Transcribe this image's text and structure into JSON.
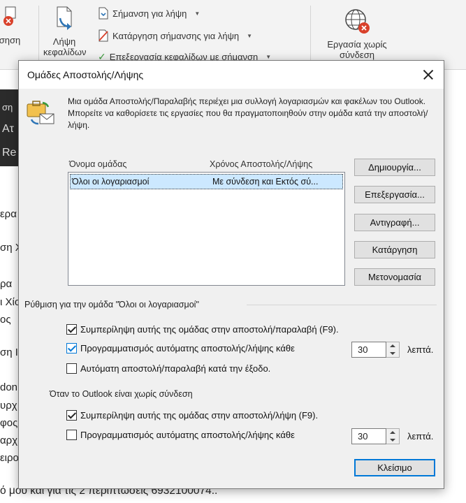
{
  "ribbon": {
    "left_label": "σηση",
    "download_label_line1": "Λήψη",
    "download_label_line2": "κεφαλίδων",
    "mark_download": "Σήμανση για λήψη",
    "unmark_download": "Κατάργηση σήμανσης για λήψη",
    "process_headers": "Επεξεργασία κεφαλίδων με σήμανση",
    "offline_line1": "Εργασία χωρίς",
    "offline_line2": "σύνδεση"
  },
  "background": {
    "pane_lines": [
      "ση",
      "Ατ",
      "Re"
    ],
    "lines": [
      "ερα",
      "ση Χ",
      "ρα",
      "ι Χίο",
      "ος",
      "ση Ι",
      "don",
      "υρχ",
      "φος",
      "αρχ",
      "ειρο"
    ],
    "bottom_line": "ό μου και για τις 2 περιπτώσεις 6932100074.."
  },
  "dialog": {
    "title": "Ομάδες Αποστολής/Λήψης",
    "description": "Μια ομάδα Αποστολής/Παραλαβής περιέχει μια συλλογή λογαριασμών και φακέλων του Outlook. Μπορείτε να καθορίσετε τις εργασίες που θα πραγματοποιηθούν στην ομάδα κατά την αποστολή/λήψη.",
    "columns": [
      "Όνομα ομάδας",
      "Χρόνος Αποστολής/Λήψης"
    ],
    "rows": [
      {
        "name": "Όλοι οι λογαριασμοί",
        "time": "Με σύνδεση και Εκτός σύ..."
      }
    ],
    "buttons": {
      "create": "Δημιουργία...",
      "edit": "Επεξεργασία...",
      "copy": "Αντιγραφή...",
      "remove": "Κατάργηση",
      "rename": "Μετονομασία",
      "close": "Κλείσιμο"
    },
    "settings_label": "Ρύθμιση για την ομάδα \"Όλοι οι λογαριασμοί\"",
    "online": {
      "include_label": "Συμπερίληψη αυτής της ομάδας στην αποστολή/παραλαβή (F9).",
      "include_checked": true,
      "schedule_label": "Προγραμματισμός αυτόματης αποστολής/λήψης κάθε",
      "schedule_checked": true,
      "schedule_minutes": "30",
      "minutes_unit": "λεπτά.",
      "on_exit_label": "Αυτόματη αποστολή/παραλαβή κατά την έξοδο.",
      "on_exit_checked": false
    },
    "offline_label": "Όταν το Outlook είναι χωρίς σύνδεση",
    "offline": {
      "include_label": "Συμπερίληψη αυτής της ομάδας στην αποστολή/λήψη (F9).",
      "include_checked": true,
      "schedule_label": "Προγραμματισμός αυτόματης αποστολής/λήψης κάθε",
      "schedule_checked": false,
      "schedule_minutes": "30",
      "minutes_unit": "λεπτά."
    }
  },
  "colors": {
    "accent": "#0078d7",
    "selection": "#cce8ff",
    "error_red": "#d9412b"
  }
}
